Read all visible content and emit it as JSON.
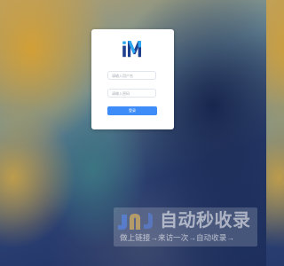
{
  "login": {
    "logo_text": "iM",
    "username_placeholder": "请输入用户名",
    "password_placeholder": "请输入密码",
    "login_button": "登录"
  },
  "watermark": {
    "title": "自动秒收录",
    "tagline": "做上链接→来访一次→自动收录→"
  },
  "colors": {
    "accent": "#3e8cf7",
    "logo_dark": "#1f3f8f",
    "logo_light": "#2ea7f2"
  }
}
